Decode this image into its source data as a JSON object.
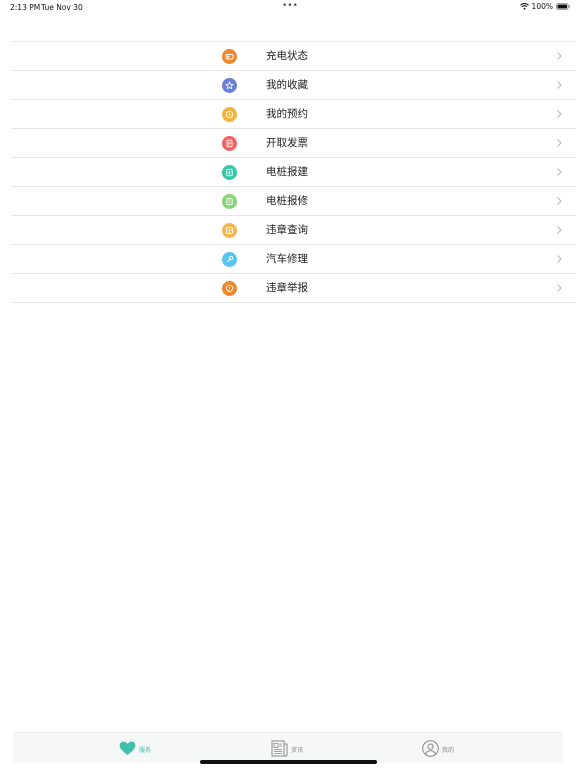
{
  "status_bar": {
    "time": "2:13 PM",
    "date": "Tue Nov 30",
    "dots": "•••",
    "battery_percent": "100%"
  },
  "menu": {
    "items": [
      {
        "label": "充电状态",
        "icon": "battery-card-icon",
        "color": "#f0872a"
      },
      {
        "label": "我的收藏",
        "icon": "star-icon",
        "color": "#6c7fd8"
      },
      {
        "label": "我的预约",
        "icon": "clock-icon",
        "color": "#f4b23c"
      },
      {
        "label": "开取发票",
        "icon": "invoice-icon",
        "color": "#ef6461"
      },
      {
        "label": "电桩报建",
        "icon": "charger-build-icon",
        "color": "#34c7a8"
      },
      {
        "label": "电桩报修",
        "icon": "charger-repair-icon",
        "color": "#86d478"
      },
      {
        "label": "违章查询",
        "icon": "violation-search-icon",
        "color": "#f5b64a"
      },
      {
        "label": "汽车修理",
        "icon": "car-repair-icon",
        "color": "#5ac3ec"
      },
      {
        "label": "违章举报",
        "icon": "report-icon",
        "color": "#f0872a"
      }
    ]
  },
  "tab_bar": {
    "tabs": [
      {
        "label": "服务",
        "icon": "heart-icon",
        "active": true
      },
      {
        "label": "资讯",
        "icon": "newspaper-icon",
        "active": false
      },
      {
        "label": "我的",
        "icon": "user-icon",
        "active": false
      }
    ],
    "active_color": "#3fbfae",
    "inactive_color": "#888888"
  }
}
